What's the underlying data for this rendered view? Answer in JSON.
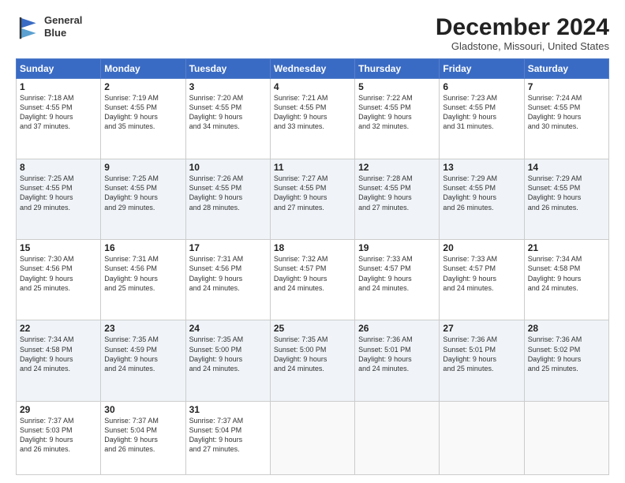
{
  "logo": {
    "line1": "General",
    "line2": "Blue"
  },
  "header": {
    "month": "December 2024",
    "location": "Gladstone, Missouri, United States"
  },
  "weekdays": [
    "Sunday",
    "Monday",
    "Tuesday",
    "Wednesday",
    "Thursday",
    "Friday",
    "Saturday"
  ],
  "weeks": [
    [
      {
        "day": "1",
        "info": "Sunrise: 7:18 AM\nSunset: 4:55 PM\nDaylight: 9 hours\nand 37 minutes."
      },
      {
        "day": "2",
        "info": "Sunrise: 7:19 AM\nSunset: 4:55 PM\nDaylight: 9 hours\nand 35 minutes."
      },
      {
        "day": "3",
        "info": "Sunrise: 7:20 AM\nSunset: 4:55 PM\nDaylight: 9 hours\nand 34 minutes."
      },
      {
        "day": "4",
        "info": "Sunrise: 7:21 AM\nSunset: 4:55 PM\nDaylight: 9 hours\nand 33 minutes."
      },
      {
        "day": "5",
        "info": "Sunrise: 7:22 AM\nSunset: 4:55 PM\nDaylight: 9 hours\nand 32 minutes."
      },
      {
        "day": "6",
        "info": "Sunrise: 7:23 AM\nSunset: 4:55 PM\nDaylight: 9 hours\nand 31 minutes."
      },
      {
        "day": "7",
        "info": "Sunrise: 7:24 AM\nSunset: 4:55 PM\nDaylight: 9 hours\nand 30 minutes."
      }
    ],
    [
      {
        "day": "8",
        "info": "Sunrise: 7:25 AM\nSunset: 4:55 PM\nDaylight: 9 hours\nand 29 minutes."
      },
      {
        "day": "9",
        "info": "Sunrise: 7:25 AM\nSunset: 4:55 PM\nDaylight: 9 hours\nand 29 minutes."
      },
      {
        "day": "10",
        "info": "Sunrise: 7:26 AM\nSunset: 4:55 PM\nDaylight: 9 hours\nand 28 minutes."
      },
      {
        "day": "11",
        "info": "Sunrise: 7:27 AM\nSunset: 4:55 PM\nDaylight: 9 hours\nand 27 minutes."
      },
      {
        "day": "12",
        "info": "Sunrise: 7:28 AM\nSunset: 4:55 PM\nDaylight: 9 hours\nand 27 minutes."
      },
      {
        "day": "13",
        "info": "Sunrise: 7:29 AM\nSunset: 4:55 PM\nDaylight: 9 hours\nand 26 minutes."
      },
      {
        "day": "14",
        "info": "Sunrise: 7:29 AM\nSunset: 4:55 PM\nDaylight: 9 hours\nand 26 minutes."
      }
    ],
    [
      {
        "day": "15",
        "info": "Sunrise: 7:30 AM\nSunset: 4:56 PM\nDaylight: 9 hours\nand 25 minutes."
      },
      {
        "day": "16",
        "info": "Sunrise: 7:31 AM\nSunset: 4:56 PM\nDaylight: 9 hours\nand 25 minutes."
      },
      {
        "day": "17",
        "info": "Sunrise: 7:31 AM\nSunset: 4:56 PM\nDaylight: 9 hours\nand 24 minutes."
      },
      {
        "day": "18",
        "info": "Sunrise: 7:32 AM\nSunset: 4:57 PM\nDaylight: 9 hours\nand 24 minutes."
      },
      {
        "day": "19",
        "info": "Sunrise: 7:33 AM\nSunset: 4:57 PM\nDaylight: 9 hours\nand 24 minutes."
      },
      {
        "day": "20",
        "info": "Sunrise: 7:33 AM\nSunset: 4:57 PM\nDaylight: 9 hours\nand 24 minutes."
      },
      {
        "day": "21",
        "info": "Sunrise: 7:34 AM\nSunset: 4:58 PM\nDaylight: 9 hours\nand 24 minutes."
      }
    ],
    [
      {
        "day": "22",
        "info": "Sunrise: 7:34 AM\nSunset: 4:58 PM\nDaylight: 9 hours\nand 24 minutes."
      },
      {
        "day": "23",
        "info": "Sunrise: 7:35 AM\nSunset: 4:59 PM\nDaylight: 9 hours\nand 24 minutes."
      },
      {
        "day": "24",
        "info": "Sunrise: 7:35 AM\nSunset: 5:00 PM\nDaylight: 9 hours\nand 24 minutes."
      },
      {
        "day": "25",
        "info": "Sunrise: 7:35 AM\nSunset: 5:00 PM\nDaylight: 9 hours\nand 24 minutes."
      },
      {
        "day": "26",
        "info": "Sunrise: 7:36 AM\nSunset: 5:01 PM\nDaylight: 9 hours\nand 24 minutes."
      },
      {
        "day": "27",
        "info": "Sunrise: 7:36 AM\nSunset: 5:01 PM\nDaylight: 9 hours\nand 25 minutes."
      },
      {
        "day": "28",
        "info": "Sunrise: 7:36 AM\nSunset: 5:02 PM\nDaylight: 9 hours\nand 25 minutes."
      }
    ],
    [
      {
        "day": "29",
        "info": "Sunrise: 7:37 AM\nSunset: 5:03 PM\nDaylight: 9 hours\nand 26 minutes."
      },
      {
        "day": "30",
        "info": "Sunrise: 7:37 AM\nSunset: 5:04 PM\nDaylight: 9 hours\nand 26 minutes."
      },
      {
        "day": "31",
        "info": "Sunrise: 7:37 AM\nSunset: 5:04 PM\nDaylight: 9 hours\nand 27 minutes."
      },
      {
        "day": "",
        "info": ""
      },
      {
        "day": "",
        "info": ""
      },
      {
        "day": "",
        "info": ""
      },
      {
        "day": "",
        "info": ""
      }
    ]
  ]
}
